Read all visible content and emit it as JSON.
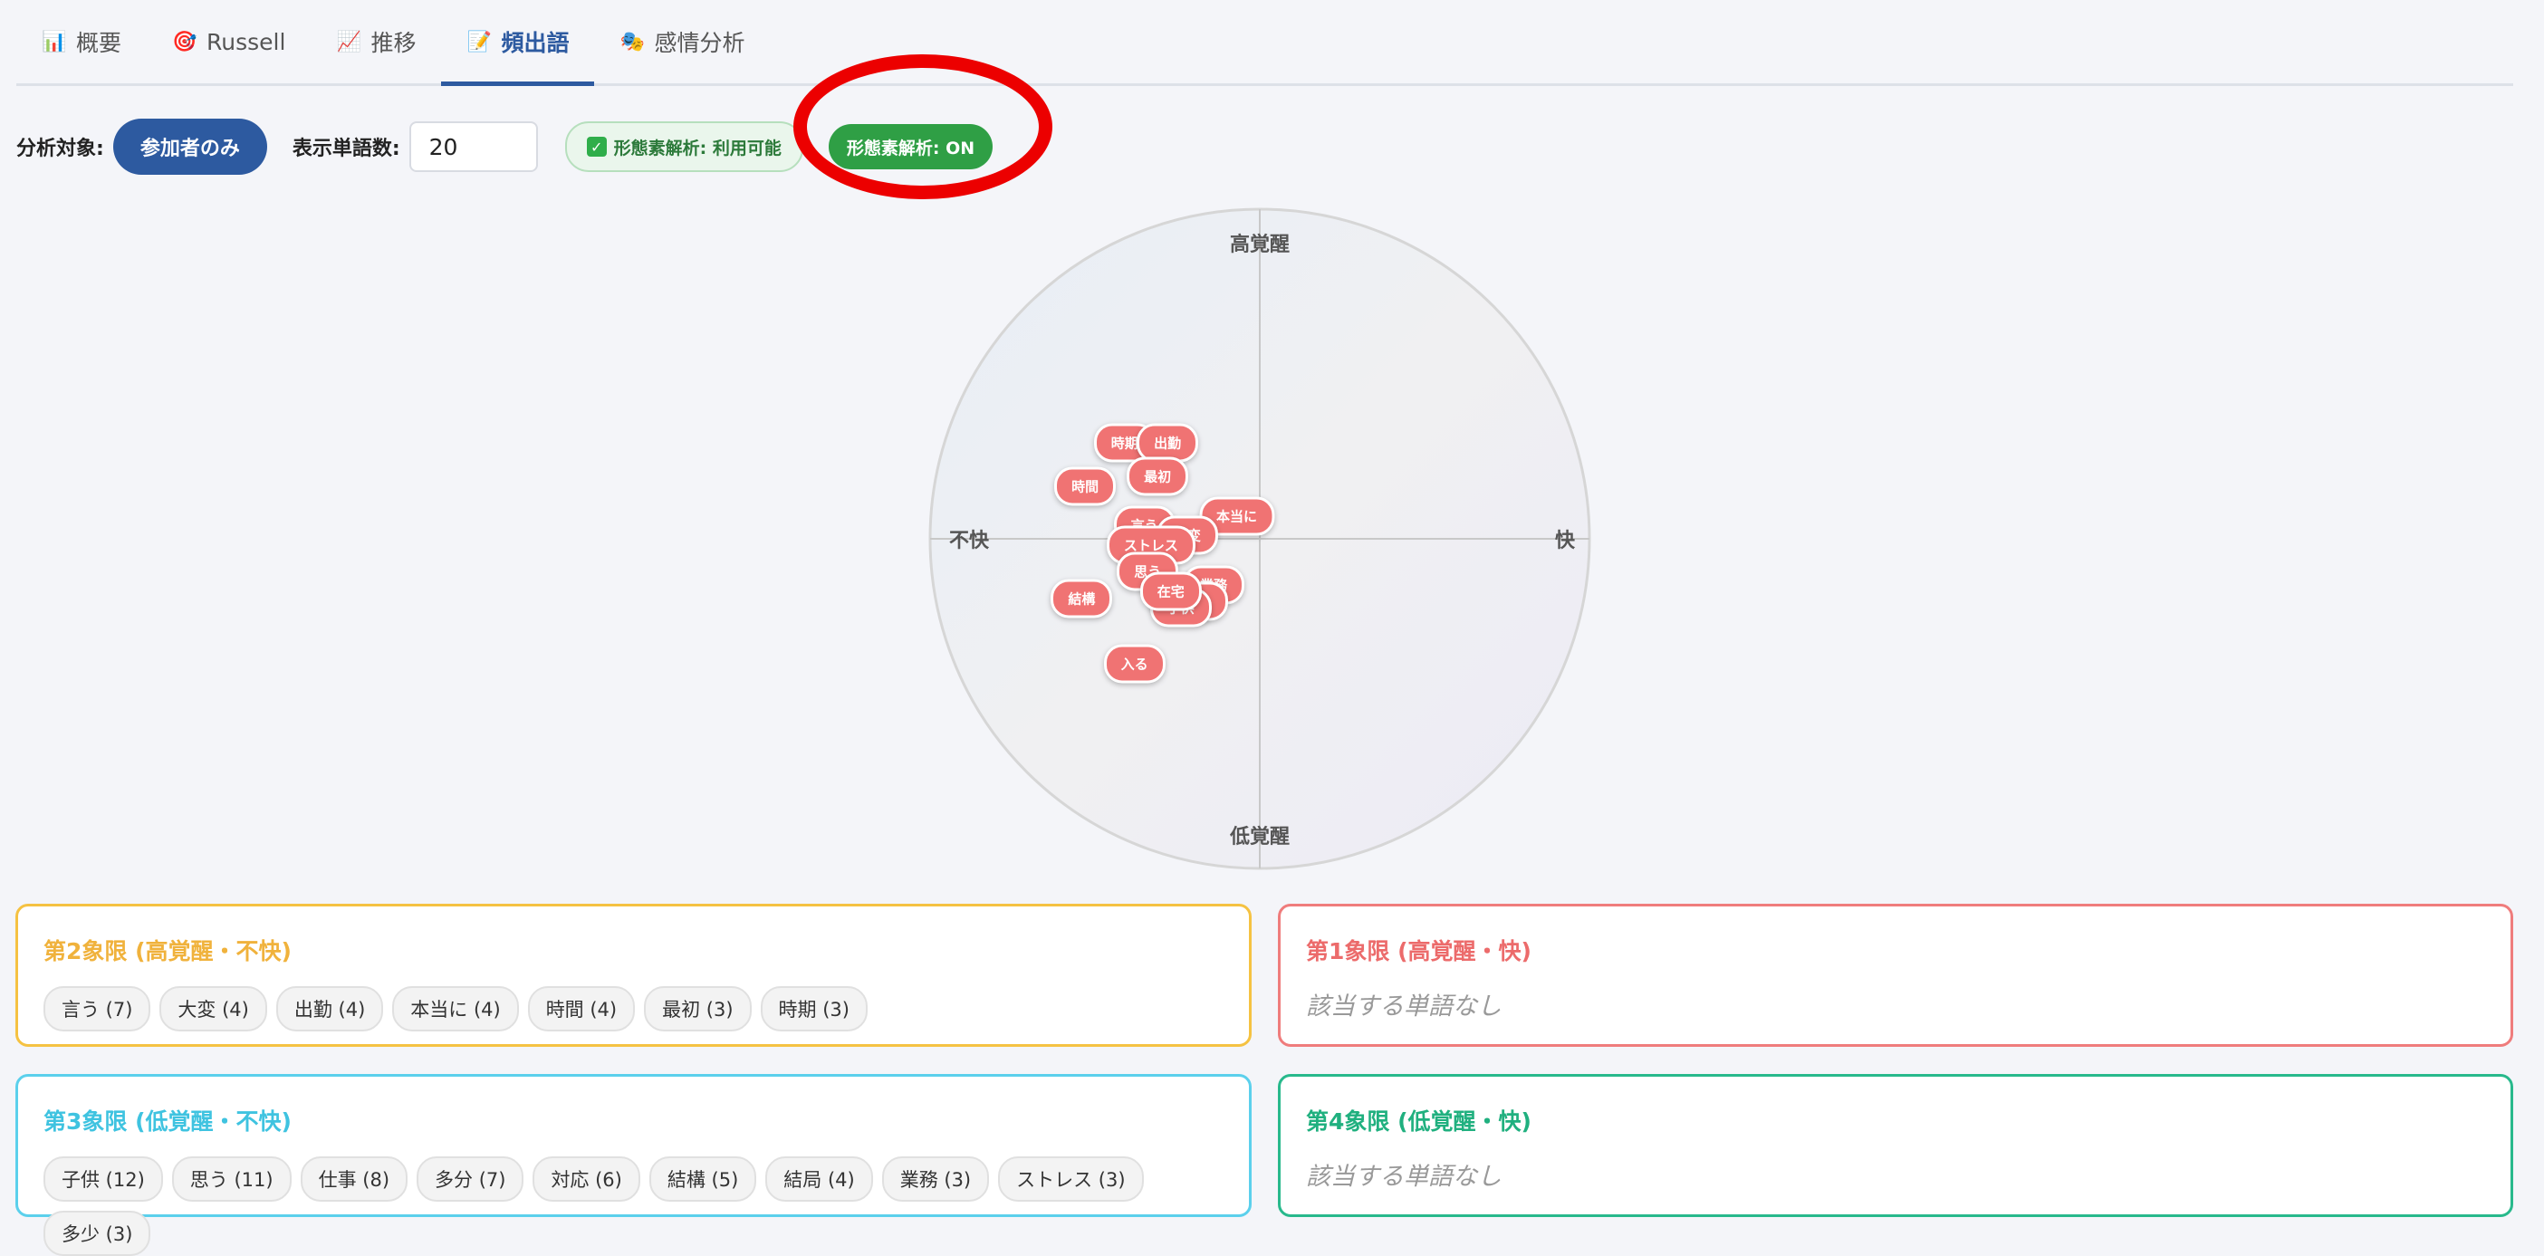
{
  "tabs": [
    {
      "icon": "📊",
      "label": "概要"
    },
    {
      "icon": "🎯",
      "label": "Russell"
    },
    {
      "icon": "📈",
      "label": "推移"
    },
    {
      "icon": "📝",
      "label": "頻出語"
    },
    {
      "icon": "🎭",
      "label": "感情分析"
    }
  ],
  "active_tab": "頻出語",
  "controls": {
    "target_label": "分析対象:",
    "target_value": "参加者のみ",
    "word_count_label": "表示単語数:",
    "word_count_value": "20",
    "morph_available": "形態素解析: 利用可能",
    "morph_toggle": "形態素解析: ON"
  },
  "chart": {
    "axis_top": "高覚醒",
    "axis_bottom": "低覚醒",
    "axis_left": "不快",
    "axis_right": "快",
    "bubble_color": "#f07373",
    "words": [
      {
        "label": "時期",
        "valence": -0.41,
        "arousal": 0.29
      },
      {
        "label": "出勤",
        "valence": -0.28,
        "arousal": 0.29
      },
      {
        "label": "最初",
        "valence": -0.31,
        "arousal": 0.19
      },
      {
        "label": "時間",
        "valence": -0.53,
        "arousal": 0.16
      },
      {
        "label": "本当に",
        "valence": -0.07,
        "arousal": 0.07
      },
      {
        "label": "言う",
        "valence": -0.35,
        "arousal": 0.04
      },
      {
        "label": "大変",
        "valence": -0.22,
        "arousal": 0.01
      },
      {
        "label": "ストレス",
        "valence": -0.33,
        "arousal": -0.02
      },
      {
        "label": "思う",
        "valence": -0.34,
        "arousal": -0.1
      },
      {
        "label": "業務",
        "valence": -0.14,
        "arousal": -0.14
      },
      {
        "label": "多少",
        "valence": -0.19,
        "arousal": -0.19
      },
      {
        "label": "子供",
        "valence": -0.24,
        "arousal": -0.21
      },
      {
        "label": "在宅",
        "valence": -0.27,
        "arousal": -0.16
      },
      {
        "label": "結構",
        "valence": -0.54,
        "arousal": -0.18
      },
      {
        "label": "入る",
        "valence": -0.38,
        "arousal": -0.38
      }
    ]
  },
  "quadrants": {
    "q2": {
      "title": "第2象限 (高覚醒・不快)",
      "chips": [
        "言う (7)",
        "大変 (4)",
        "出勤 (4)",
        "本当に (4)",
        "時間 (4)",
        "最初 (3)",
        "時期 (3)"
      ],
      "color": "#f5c242"
    },
    "q1": {
      "title": "第1象限 (高覚醒・快)",
      "empty": "該当する単語なし",
      "color": "#ef7c7c"
    },
    "q3": {
      "title": "第3象限 (低覚醒・不快)",
      "chips": [
        "子供 (12)",
        "思う (11)",
        "仕事 (8)",
        "多分 (7)",
        "対応 (6)",
        "結構 (5)",
        "結局 (4)",
        "業務 (3)",
        "ストレス (3)",
        "多少 (3)"
      ],
      "color": "#5bd0ec"
    },
    "q4": {
      "title": "第4象限 (低覚醒・快)",
      "empty": "該当する単語なし",
      "color": "#28b98c"
    }
  }
}
